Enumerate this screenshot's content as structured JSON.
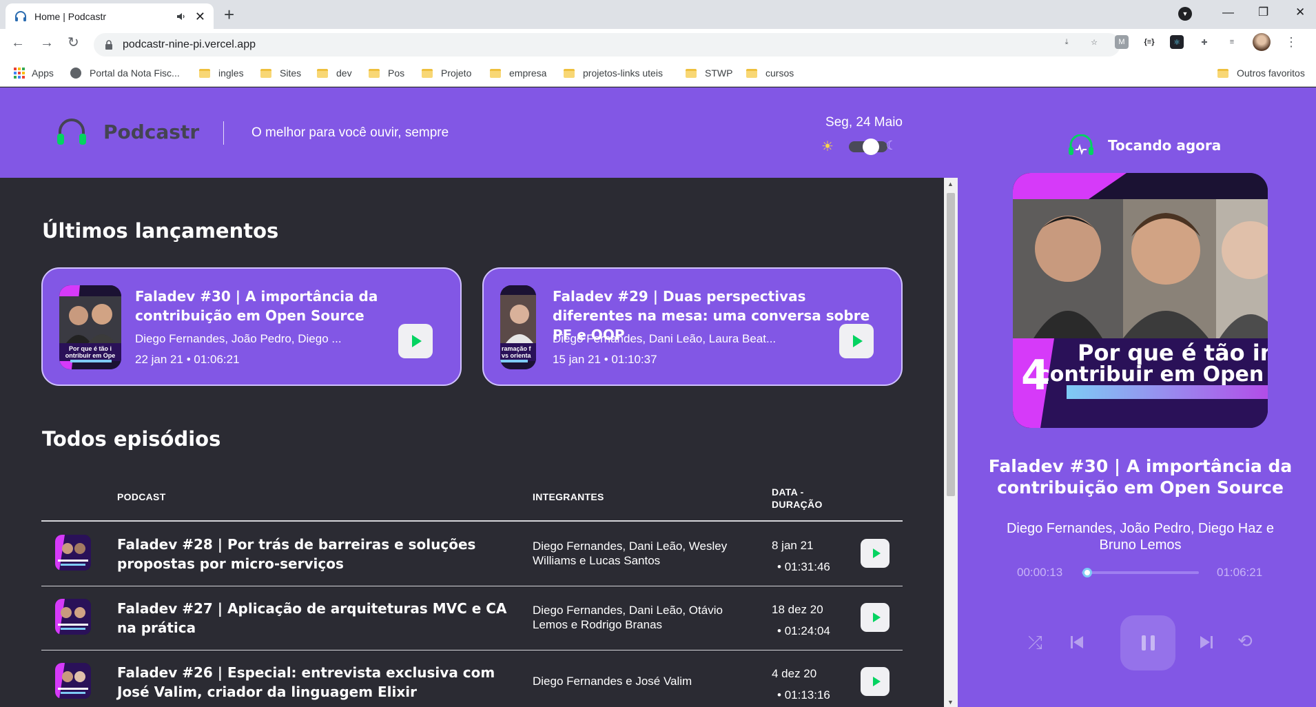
{
  "browser": {
    "tab_title": "Home | Podcastr",
    "url": "podcastr-nine-pi.vercel.app",
    "bookmarks": [
      "Apps",
      "Portal da Nota Fisc...",
      "ingles",
      "Sites",
      "dev",
      "Pos",
      "Projeto",
      "empresa",
      "projetos-links uteis",
      "STWP",
      "cursos"
    ],
    "other_bookmarks": "Outros favoritos"
  },
  "header": {
    "logo_text": "Podcastr",
    "tagline": "O melhor para você ouvir, sempre",
    "date": "Seg, 24 Maio",
    "theme": "dark"
  },
  "latest": {
    "title": "Últimos lançamentos",
    "episodes": [
      {
        "title": "Faladev #30 | A importância da contribuição em Open Source",
        "members": "Diego Fernandes, João Pedro, Diego ...",
        "date": "22 jan 21",
        "duration": "01:06:21",
        "thumb_text": "Por que é tão i contribuir em Ope"
      },
      {
        "title": "Faladev #29 | Duas perspectivas diferentes na mesa: uma conversa sobre PF e OOP",
        "members": "Diego Fernandes, Dani Leão, Laura Beat...",
        "date": "15 jan 21",
        "duration": "01:10:37",
        "thumb_text": "ramação f vs orienta"
      }
    ]
  },
  "all": {
    "title": "Todos episódios",
    "columns": {
      "podcast": "PODCAST",
      "members": "INTEGRANTES",
      "date": "DATA -",
      "duration": "DURAÇÃO"
    },
    "episodes": [
      {
        "title": "Faladev #28 | Por trás de barreiras e soluções propostas por micro-serviços",
        "members": "Diego Fernandes, Dani Leão, Wesley Williams e Lucas Santos",
        "date": "8 jan 21",
        "duration": "01:31:46"
      },
      {
        "title": "Faladev #27 | Aplicação de arquiteturas MVC e CA na prática",
        "members": "Diego Fernandes, Dani Leão, Otávio Lemos e Rodrigo Branas",
        "date": "18 dez 20",
        "duration": "01:24:04"
      },
      {
        "title": "Faladev #26 | Especial: entrevista exclusiva com José Valim, criador da linguagem Elixir",
        "members": "Diego Fernandes e José Valim",
        "date": "4 dez 20",
        "duration": "01:13:16"
      }
    ]
  },
  "player": {
    "label": "Tocando agora",
    "cover_text_line1": "Por que é tão imp",
    "cover_text_line2": "contribuir em Open S",
    "cover_number": "4",
    "title": "Faladev #30 | A importância da contribuição em Open Source",
    "members": "Diego Fernandes, João Pedro, Diego Haz e Bruno Lemos",
    "current_time": "00:00:13",
    "total_time": "01:06:21",
    "progress_fraction": 0.0033
  },
  "colors": {
    "purple": "#8257e5",
    "dark_bg": "#2b2b33",
    "play_green": "#04d361"
  }
}
